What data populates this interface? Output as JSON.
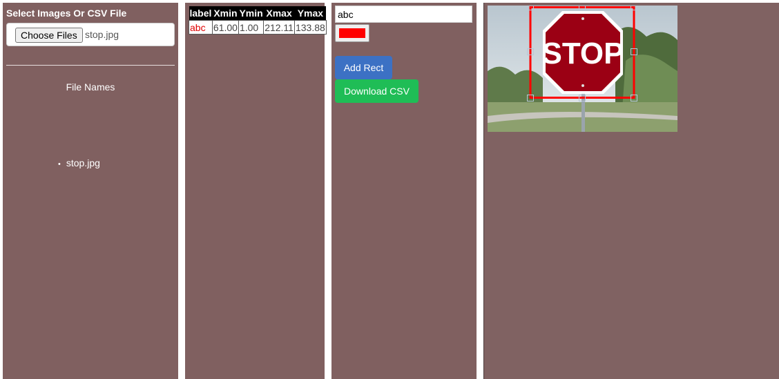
{
  "sidebar": {
    "title": "Select Images Or CSV File",
    "choose_button": "Choose Files",
    "chosen_file": "stop.jpg",
    "file_names_heading": "File Names",
    "files": [
      "stop.jpg"
    ]
  },
  "annotations_table": {
    "headers": [
      "label",
      "Xmin",
      "Ymin",
      "Xmax",
      "Ymax"
    ],
    "rows": [
      [
        "abc",
        "61.00",
        "1.00",
        "212.11",
        "133.88"
      ]
    ]
  },
  "controls": {
    "label_value": "abc",
    "color": "#ff0000",
    "add_rect_label": "Add Rect",
    "download_csv_label": "Download CSV"
  },
  "canvas": {
    "image_file": "stop.jpg",
    "sign_text": "STOP",
    "rect_color": "#ff0000"
  },
  "colors": {
    "panel_bg": "#806060",
    "add_button": "#3c71c4",
    "download_button": "#1fbd56"
  }
}
